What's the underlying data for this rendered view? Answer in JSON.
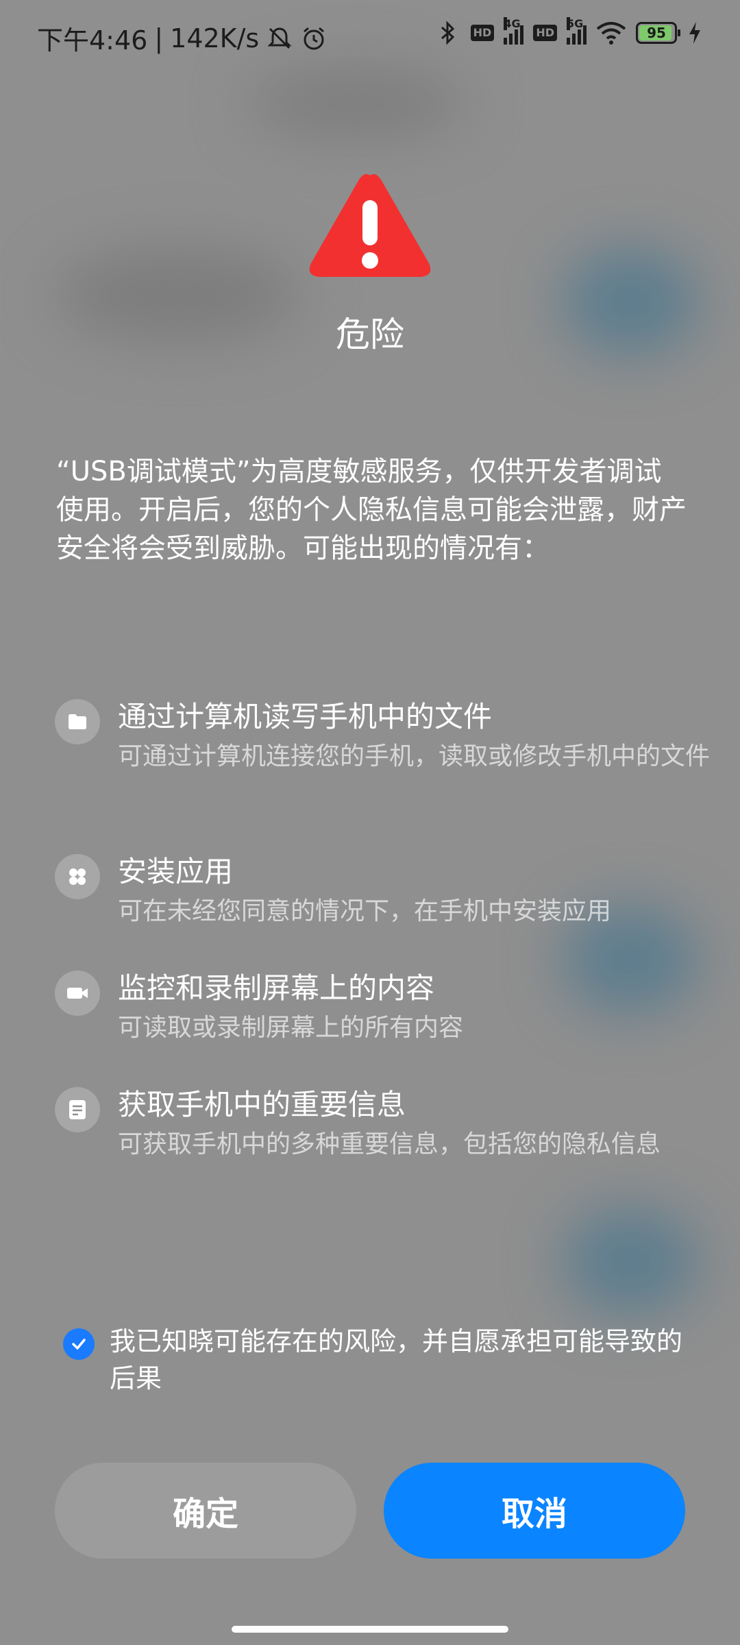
{
  "status_bar": {
    "time": "下午4:46",
    "speed": "142K/s",
    "hd1": "HD",
    "net1": "4G",
    "hd2": "HD",
    "net2": "5G",
    "battery": "95",
    "icons": [
      "mute-icon",
      "alarm-icon",
      "bluetooth-icon",
      "signal-icon",
      "wifi-icon",
      "charging-icon"
    ]
  },
  "dialog": {
    "title": "危险",
    "intro": "“USB调试模式”为高度敏感服务，仅供开发者调试使用。开启后，您的个人隐私信息可能会泄露，财产安全将会受到威胁。可能出现的情况有：",
    "items": [
      {
        "icon": "folder-icon",
        "title": "通过计算机读写手机中的文件",
        "desc": "可通过计算机连接您的手机，读取或修改手机中的文件"
      },
      {
        "icon": "apps-icon",
        "title": "安装应用",
        "desc": "可在未经您同意的情况下，在手机中安装应用"
      },
      {
        "icon": "video-camera-icon",
        "title": "监控和录制屏幕上的内容",
        "desc": "可读取或录制屏幕上的所有内容"
      },
      {
        "icon": "document-icon",
        "title": "获取手机中的重要信息",
        "desc": "可获取手机中的多种重要信息，包括您的隐私信息"
      }
    ],
    "consent": {
      "checked": true,
      "text": "我已知晓可能存在的风险，并自愿承担可能导致的后果"
    },
    "buttons": {
      "confirm": "确定",
      "cancel": "取消"
    }
  },
  "colors": {
    "accent": "#0b84ff",
    "warning": "#f23030",
    "background": "#8f8f8f",
    "battery_fill": "#7ec96b"
  }
}
